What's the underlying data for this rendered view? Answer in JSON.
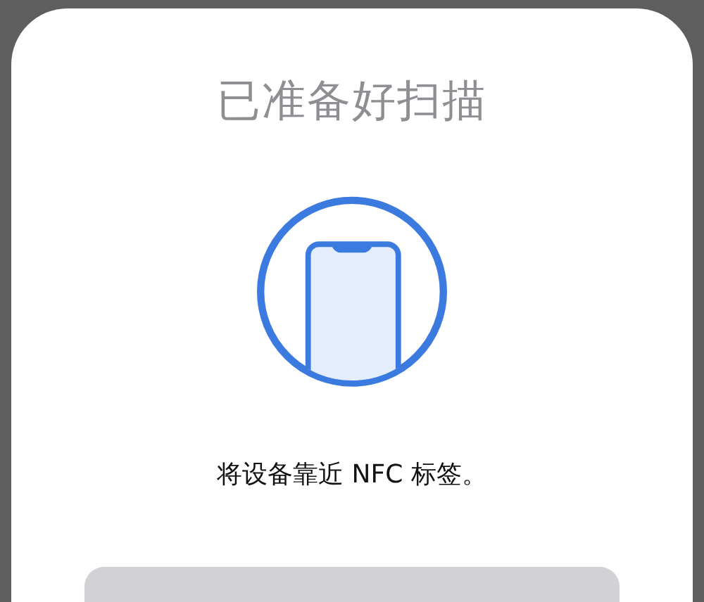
{
  "sheet": {
    "title": "已准备好扫描",
    "message": "将设备靠近 NFC 标签。"
  }
}
